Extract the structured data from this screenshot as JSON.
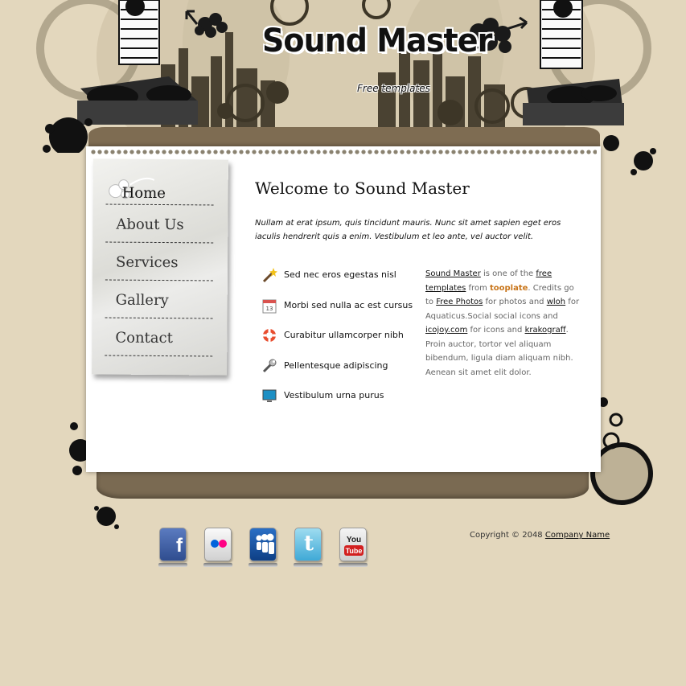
{
  "header": {
    "logo_title": "Sound Master",
    "logo_subtitle": "Free templates"
  },
  "nav": {
    "items": [
      {
        "label": "Home",
        "active": true
      },
      {
        "label": "About Us",
        "active": false
      },
      {
        "label": "Services",
        "active": false
      },
      {
        "label": "Gallery",
        "active": false
      },
      {
        "label": "Contact",
        "active": false
      }
    ]
  },
  "content": {
    "welcome_title": "Welcome to Sound Master",
    "intro_text": "Nullam at erat ipsum, quis tincidunt mauris. Nunc sit amet sapien eget eros iaculis hendrerit quis a enim. Vestibulum et leo ante, vel auctor velit.",
    "features": [
      {
        "icon": "magic-wand-icon",
        "label": "Sed nec eros egestas nisl"
      },
      {
        "icon": "calendar-icon",
        "label": "Morbi sed nulla ac est cursus"
      },
      {
        "icon": "lifebuoy-icon",
        "label": "Curabitur ullamcorper nibh"
      },
      {
        "icon": "wrench-icon",
        "label": "Pellentesque adipiscing"
      },
      {
        "icon": "monitor-icon",
        "label": "Vestibulum urna purus"
      }
    ],
    "credits": {
      "link_sound_master": "Sound Master",
      "text_1": " is one of the ",
      "link_free_templates": "free templates",
      "text_2": " from ",
      "link_tooplate": "tooplate",
      "text_3": ". Credits go to ",
      "link_free_photos": "Free Photos",
      "text_4": " for photos and ",
      "link_wloh": "wloh",
      "text_5": " for Aquaticus.Social social icons and ",
      "link_icojoy": "icojoy.com",
      "text_6": " for icons and ",
      "link_krakograff": "krakograff",
      "text_7": ". Proin auctor, tortor vel aliquam bibendum, ligula diam aliquam nibh. Aenean sit amet elit dolor."
    }
  },
  "footer": {
    "social": [
      {
        "name": "facebook",
        "glyph": "f",
        "color": "#3b5998"
      },
      {
        "name": "flickr",
        "glyph": "●●",
        "color": "#e8e8e8"
      },
      {
        "name": "myspace",
        "glyph": "●●",
        "color": "#1e5aa8"
      },
      {
        "name": "twitter",
        "glyph": "t",
        "color": "#5fc1e0"
      },
      {
        "name": "youtube",
        "glyph": "You Tube",
        "color": "#d8d8d8"
      }
    ],
    "copyright_text": "Copyright © 2048 ",
    "company_link": "Company Name"
  },
  "colors": {
    "background": "#e3d7bd",
    "torn_paper": "#7a6a52",
    "accent_tooplate": "#c8751a"
  }
}
